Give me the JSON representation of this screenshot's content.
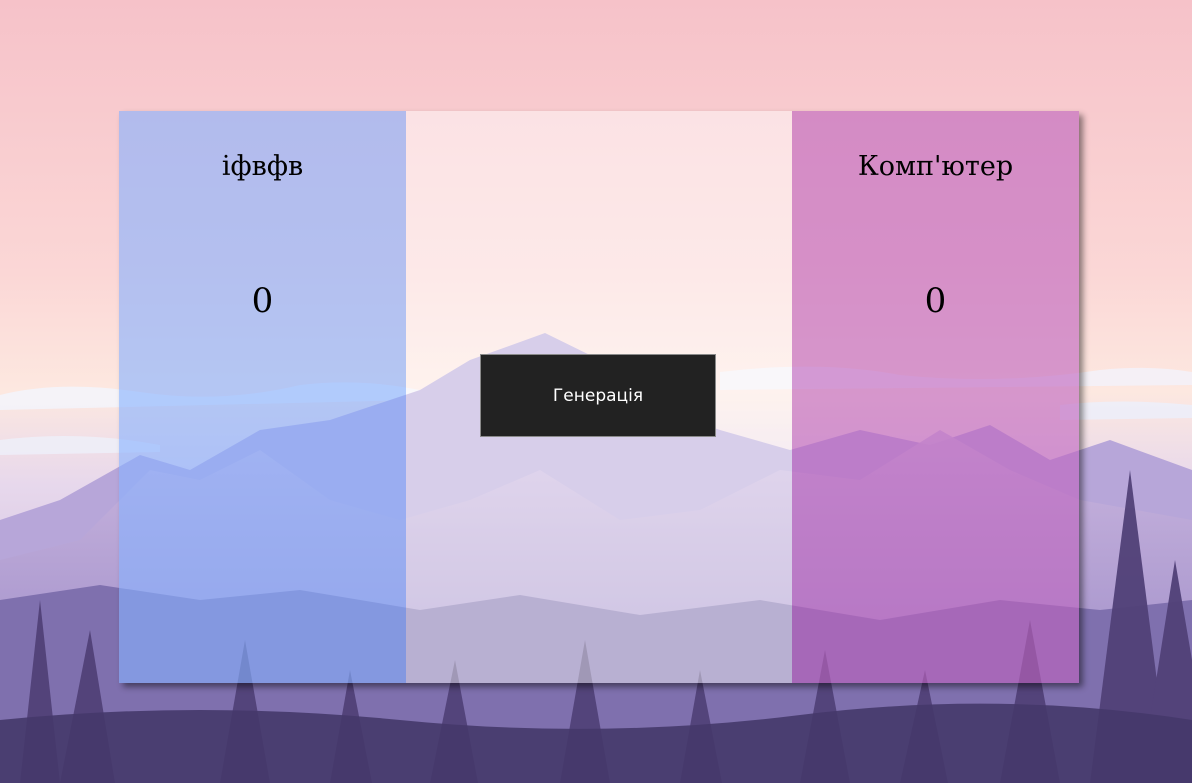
{
  "players": {
    "left": {
      "name": "іфвфв",
      "score": "0"
    },
    "right": {
      "name": "Комп'ютер",
      "score": "0"
    }
  },
  "controls": {
    "generate_label": "Генерація"
  },
  "colors": {
    "left_panel": "#87b2ff",
    "right_panel": "#be64be",
    "button_bg": "#222222",
    "sky_top": "#f7c6cc",
    "mountains": "#7b6fb0"
  }
}
